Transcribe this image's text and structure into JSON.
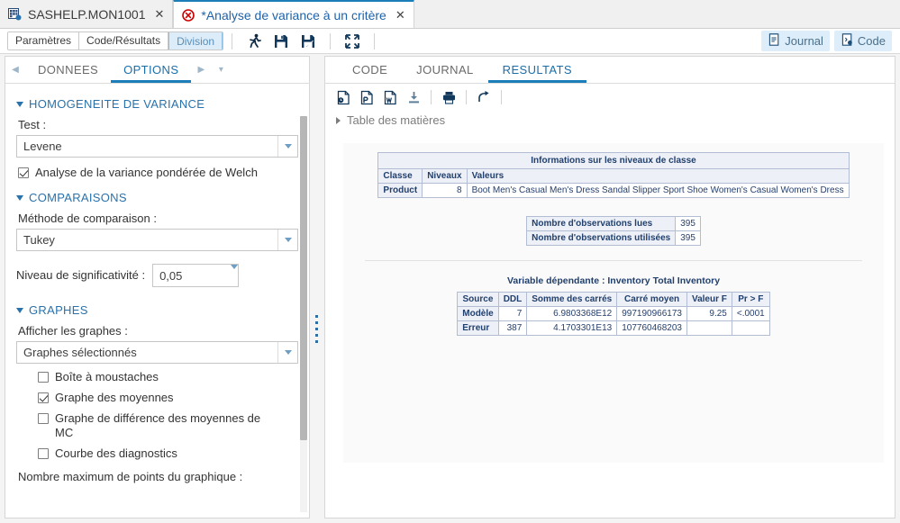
{
  "window": {
    "tabs": [
      {
        "label": "SASHELP.MON1001",
        "icon": "table-grid-icon",
        "active": false,
        "modified": false
      },
      {
        "label": "*Analyse de variance à un critère",
        "icon": "error-circle-icon",
        "active": true,
        "modified": true
      }
    ],
    "close_label": "✕"
  },
  "toolbar": {
    "segments": [
      {
        "label": "Paramètres",
        "selected": false
      },
      {
        "label": "Code/Résultats",
        "selected": false
      },
      {
        "label": "Division",
        "selected": true
      }
    ],
    "icons": [
      {
        "name": "run-icon",
        "title": "Exécuter"
      },
      {
        "name": "save-icon",
        "title": "Enregistrer"
      },
      {
        "name": "save-as-icon",
        "title": "Enregistrer sous"
      },
      {
        "name": "maximize-icon",
        "title": "Agrandir"
      }
    ],
    "right_buttons": [
      {
        "label": "Journal",
        "icon": "log-icon"
      },
      {
        "label": "Code",
        "icon": "code-icon"
      }
    ]
  },
  "left_panel": {
    "tabs": [
      {
        "label": "DONNEES",
        "active": false
      },
      {
        "label": "OPTIONS",
        "active": true
      }
    ],
    "nav": {
      "prev": "◀",
      "next": "▶",
      "more": "▾"
    },
    "sections": {
      "homogeneity": {
        "title": "HOMOGENEITE DE VARIANCE",
        "test_label": "Test :",
        "test_value": "Levene",
        "welch": {
          "label": "Analyse de la variance pondérée de Welch",
          "checked": true
        }
      },
      "comparisons": {
        "title": "COMPARAISONS",
        "method_label": "Méthode de comparaison :",
        "method_value": "Tukey",
        "alpha_label": "Niveau de significativité :",
        "alpha_value": "0,05"
      },
      "graphs": {
        "title": "GRAPHES",
        "display_label": "Afficher les graphes :",
        "display_value": "Graphes sélectionnés",
        "options": [
          {
            "label": "Boîte à moustaches",
            "checked": false
          },
          {
            "label": "Graphe des moyennes",
            "checked": true
          },
          {
            "label": "Graphe de différence des moyennes de MC",
            "checked": false
          },
          {
            "label": "Courbe des diagnostics",
            "checked": false
          }
        ],
        "maxpoints_label": "Nombre maximum de points du graphique :"
      }
    }
  },
  "right_panel": {
    "tabs": [
      {
        "label": "CODE",
        "active": false
      },
      {
        "label": "JOURNAL",
        "active": false
      },
      {
        "label": "RESULTATS",
        "active": true
      }
    ],
    "toolbar_icons": [
      {
        "name": "export-html-icon",
        "title": "HTML"
      },
      {
        "name": "export-pdf-icon",
        "title": "PDF"
      },
      {
        "name": "export-word-icon",
        "title": "Word"
      },
      {
        "name": "download-icon",
        "title": "Télécharger"
      },
      {
        "name": "print-icon",
        "title": "Imprimer"
      },
      {
        "name": "open-new-window-icon",
        "title": "Ouvrir"
      }
    ],
    "toc_label": "Table des matières"
  },
  "results": {
    "class_levels": {
      "title": "Informations sur les niveaux de classe",
      "headers": [
        "Classe",
        "Niveaux",
        "Valeurs"
      ],
      "row": {
        "classe": "Product",
        "niveaux": "8",
        "valeurs": "Boot Men's Casual Men's Dress Sandal Slipper Sport Shoe Women's Casual Women's Dress"
      }
    },
    "observations": {
      "rows": [
        {
          "label": "Nombre d'observations lues",
          "value": "395"
        },
        {
          "label": "Nombre d'observations utilisées",
          "value": "395"
        }
      ]
    },
    "anova": {
      "dependent_title": "Variable dépendante : Inventory Total Inventory",
      "headers": [
        "Source",
        "DDL",
        "Somme des carrés",
        "Carré moyen",
        "Valeur F",
        "Pr > F"
      ],
      "rows": [
        {
          "source": "Modèle",
          "ddl": "7",
          "ss": "6.9803368E12",
          "ms": "997190966173",
          "f": "9.25",
          "p": "<.0001"
        },
        {
          "source": "Erreur",
          "ddl": "387",
          "ss": "4.1703301E13",
          "ms": "107760468203",
          "f": "",
          "p": ""
        }
      ]
    }
  },
  "colors": {
    "accent": "#1b7eb8",
    "link": "#2a72ab",
    "sas_table_border": "#b2bdd4",
    "sas_header_bg": "#edf0f7",
    "sas_text": "#22406d",
    "error_red": "#cc0000"
  }
}
